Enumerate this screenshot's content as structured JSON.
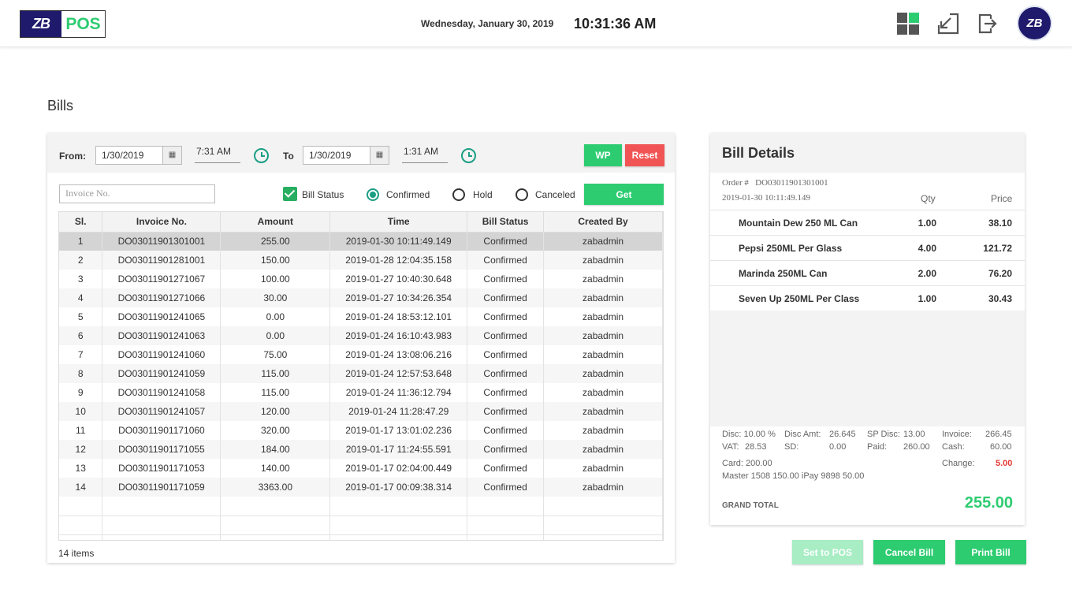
{
  "header": {
    "logo_mark": "ZB",
    "logo_text": "POS",
    "date": "Wednesday, January 30, 2019",
    "time": "10:31:36 AM",
    "avatar_text": "ZB"
  },
  "page": {
    "title": "Bills"
  },
  "filters": {
    "from_label": "From:",
    "from_date": "1/30/2019",
    "from_time": "7:31 AM",
    "to_label": "To",
    "to_date": "1/30/2019",
    "to_time": "1:31 AM",
    "wp_label": "WP",
    "reset_label": "Reset",
    "invoice_placeholder": "Invoice No.",
    "bill_status_label": "Bill Status",
    "options": [
      "Confirmed",
      "Hold",
      "Canceled"
    ],
    "get_label": "Get"
  },
  "table": {
    "columns": [
      "Sl.",
      "Invoice No.",
      "Amount",
      "Time",
      "Bill Status",
      "Created By"
    ],
    "rows": [
      [
        "1",
        "DO03011901301001",
        "255.00",
        "2019-01-30 10:11:49.149",
        "Confirmed",
        "zabadmin"
      ],
      [
        "2",
        "DO03011901281001",
        "150.00",
        "2019-01-28 12:04:35.158",
        "Confirmed",
        "zabadmin"
      ],
      [
        "3",
        "DO03011901271067",
        "100.00",
        "2019-01-27 10:40:30.648",
        "Confirmed",
        "zabadmin"
      ],
      [
        "4",
        "DO03011901271066",
        "30.00",
        "2019-01-27 10:34:26.354",
        "Confirmed",
        "zabadmin"
      ],
      [
        "5",
        "DO03011901241065",
        "0.00",
        "2019-01-24 18:53:12.101",
        "Confirmed",
        "zabadmin"
      ],
      [
        "6",
        "DO03011901241063",
        "0.00",
        "2019-01-24 16:10:43.983",
        "Confirmed",
        "zabadmin"
      ],
      [
        "7",
        "DO03011901241060",
        "75.00",
        "2019-01-24 13:08:06.216",
        "Confirmed",
        "zabadmin"
      ],
      [
        "8",
        "DO03011901241059",
        "115.00",
        "2019-01-24 12:57:53.648",
        "Confirmed",
        "zabadmin"
      ],
      [
        "9",
        "DO03011901241058",
        "115.00",
        "2019-01-24 11:36:12.794",
        "Confirmed",
        "zabadmin"
      ],
      [
        "10",
        "DO03011901241057",
        "120.00",
        "2019-01-24 11:28:47.29",
        "Confirmed",
        "zabadmin"
      ],
      [
        "11",
        "DO03011901171060",
        "320.00",
        "2019-01-17 13:01:02.236",
        "Confirmed",
        "zabadmin"
      ],
      [
        "12",
        "DO03011901171055",
        "184.00",
        "2019-01-17 11:24:55.591",
        "Confirmed",
        "zabadmin"
      ],
      [
        "13",
        "DO03011901171053",
        "140.00",
        "2019-01-17 02:04:00.449",
        "Confirmed",
        "zabadmin"
      ],
      [
        "14",
        "DO03011901171059",
        "3363.00",
        "2019-01-17 00:09:38.314",
        "Confirmed",
        "zabadmin"
      ]
    ],
    "items_count": "14 items"
  },
  "bill": {
    "title": "Bill Details",
    "order_label": "Order #",
    "order_no": "DO03011901301001",
    "order_time": "2019-01-30 10:11:49.149",
    "qty_label": "Qty",
    "price_label": "Price",
    "items": [
      {
        "name": "Mountain Dew  250 ML  Can",
        "qty": "1.00",
        "price": "38.10"
      },
      {
        "name": "Pepsi 250ML Per Glass",
        "qty": "4.00",
        "price": "121.72"
      },
      {
        "name": "Marinda 250ML Can",
        "qty": "2.00",
        "price": "76.20"
      },
      {
        "name": "Seven Up 250ML Per Class",
        "qty": "1.00",
        "price": "30.43"
      }
    ],
    "summary": {
      "disc": "Disc: 10.00 %",
      "disc_amt_label": "Disc Amt:",
      "disc_amt": "26.645",
      "sp_disc_label": "SP Disc:",
      "sp_disc": "13.00",
      "invoice_label": "Invoice:",
      "invoice": "266.45",
      "vat_label": "VAT:",
      "vat": "28.53",
      "sd_label": "SD:",
      "sd": "0.00",
      "paid_label": "Paid:",
      "paid": "260.00",
      "cash_label": "Cash:",
      "cash": "60.00",
      "card": "Card: 200.00",
      "change_label": "Change:",
      "change": "5.00",
      "cards_detail": "Master 1508 150.00   iPay 9898 50.00"
    },
    "grand_total_label": "GRAND TOTAL",
    "grand_total": "255.00"
  },
  "actions": {
    "set_to_pos": "Set to POS",
    "cancel_bill": "Cancel Bill",
    "print_bill": "Print Bill"
  },
  "colors": {
    "accent": "#2ecc71",
    "danger": "#f05454",
    "brand": "#1f1a6b",
    "teal": "#1a9e84"
  }
}
